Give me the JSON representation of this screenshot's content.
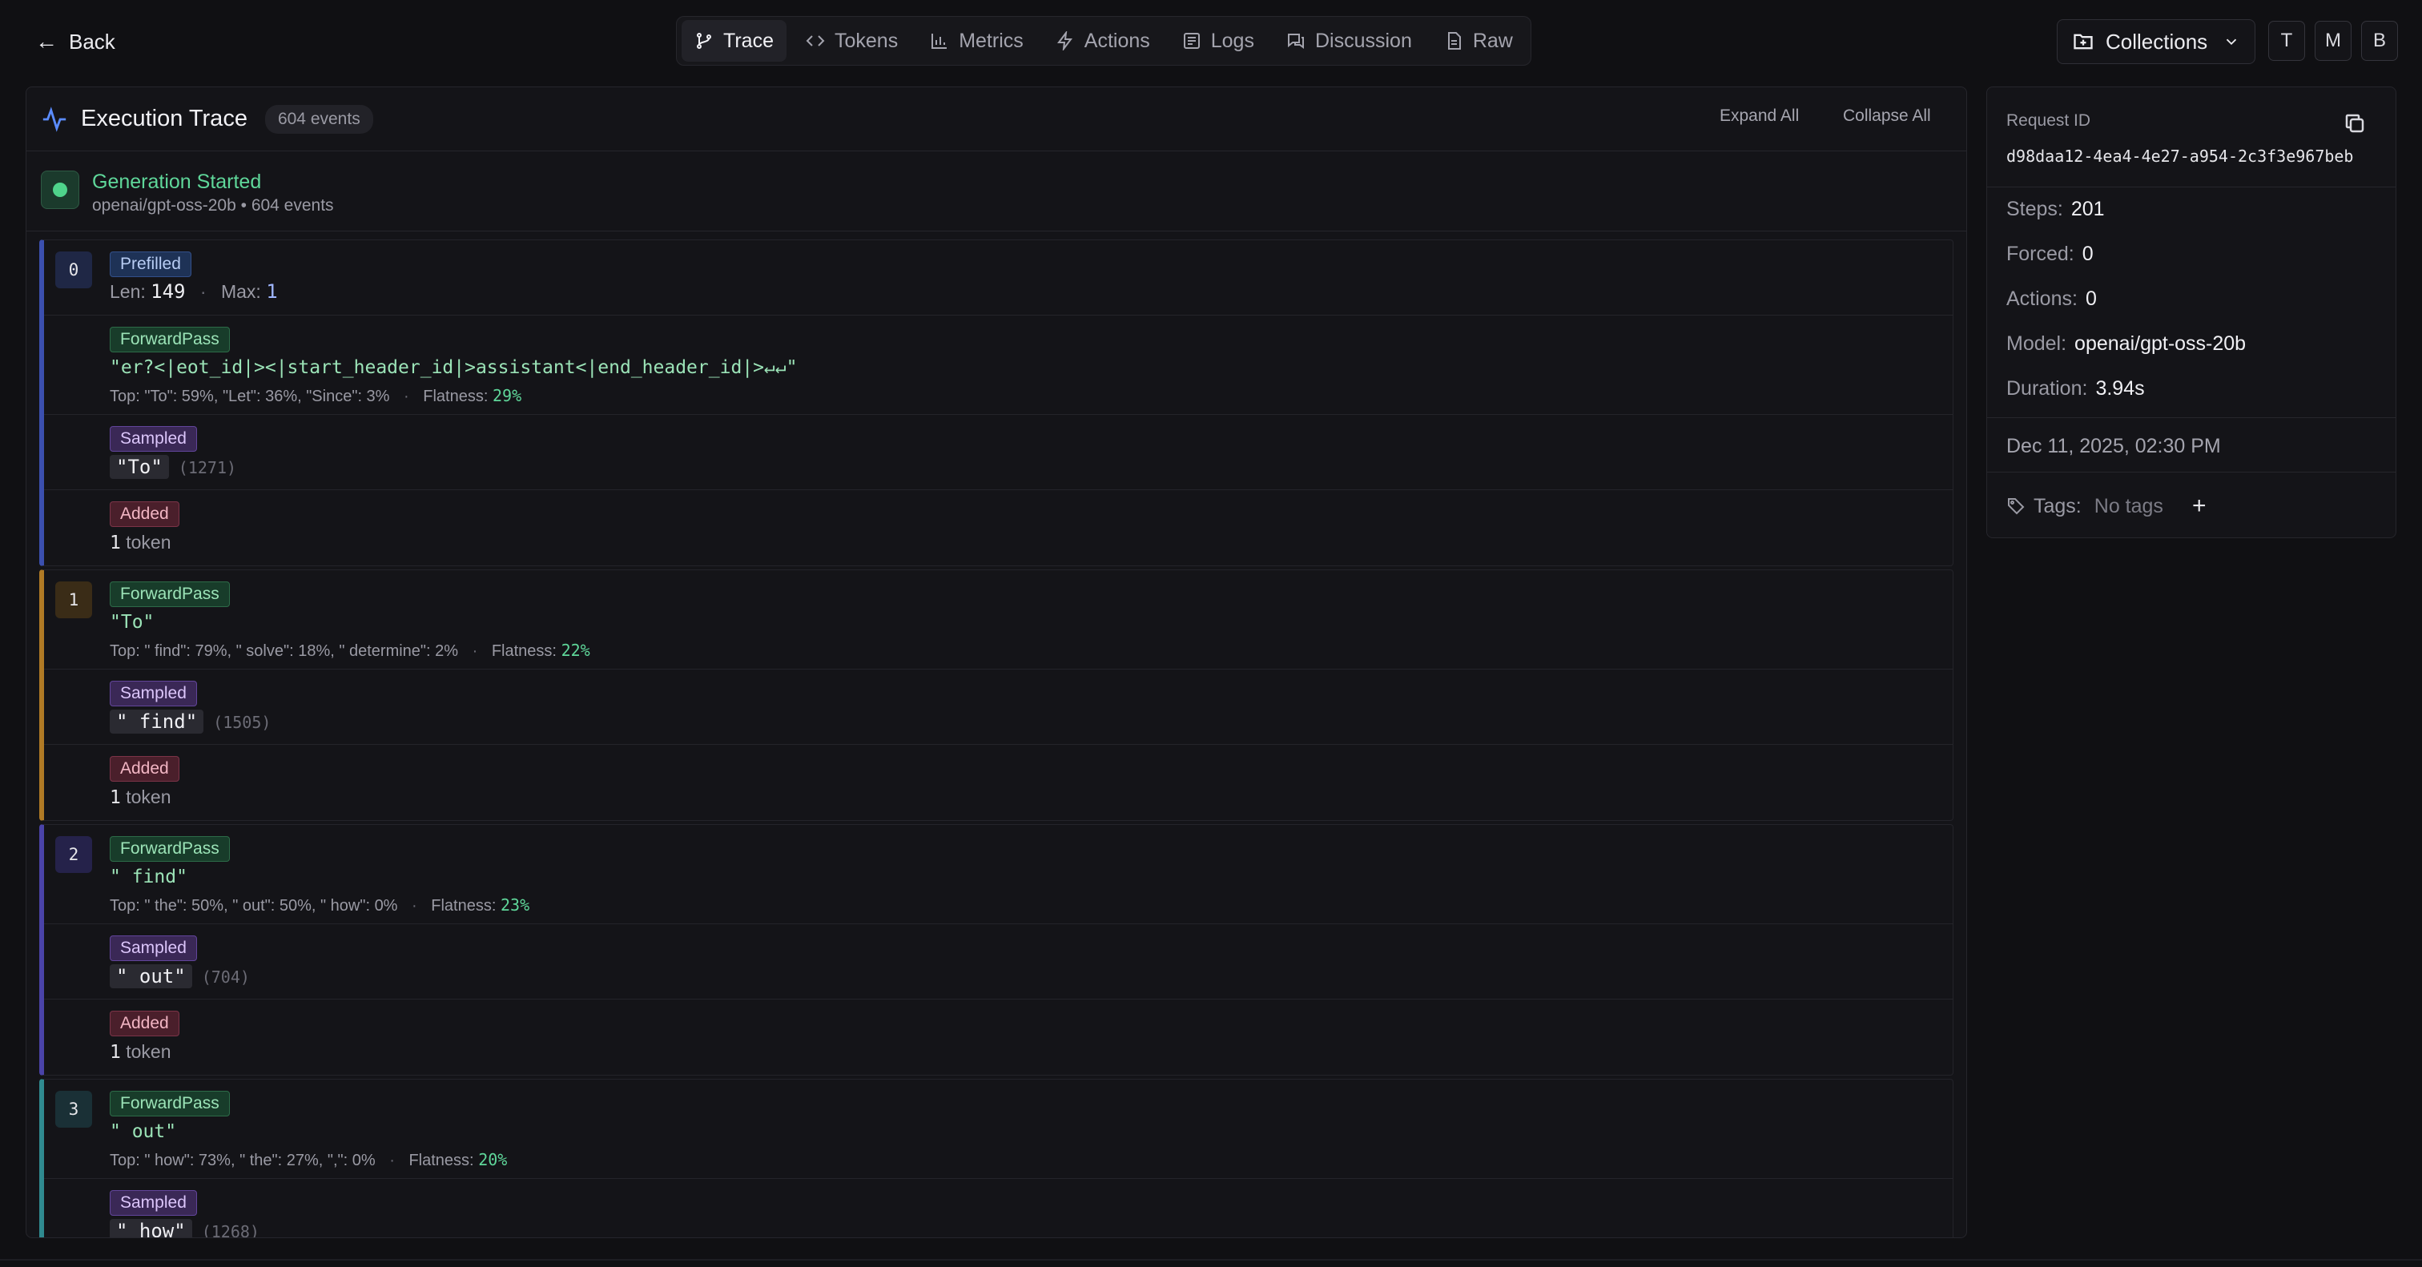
{
  "nav": {
    "back_label": "Back",
    "tabs": [
      {
        "label": "Trace",
        "icon": "branch-icon",
        "active": true
      },
      {
        "label": "Tokens",
        "icon": "code-icon",
        "active": false
      },
      {
        "label": "Metrics",
        "icon": "bar-chart-icon",
        "active": false
      },
      {
        "label": "Actions",
        "icon": "lightning-icon",
        "active": false
      },
      {
        "label": "Logs",
        "icon": "log-icon",
        "active": false
      },
      {
        "label": "Discussion",
        "icon": "chat-icon",
        "active": false
      },
      {
        "label": "Raw",
        "icon": "document-icon",
        "active": false
      }
    ],
    "collections_label": "Collections",
    "avatars": [
      "T",
      "M",
      "B"
    ]
  },
  "trace": {
    "title": "Execution Trace",
    "event_count": "604 events",
    "expand_all": "Expand All",
    "collapse_all": "Collapse All",
    "generation": {
      "title": "Generation Started",
      "subtitle": "openai/gpt-oss-20b • 604 events"
    },
    "steps": [
      {
        "index": "0",
        "prefill": {
          "badge": "Prefilled",
          "len_label": "Len:",
          "len": "149",
          "max_label": "Max:",
          "max": "1"
        },
        "forward": {
          "badge": "ForwardPass",
          "text": "\"er?<|eot_id|><|start_header_id|>assistant<|end_header_id|>↵↵\"",
          "top_label": "Top:",
          "top": "\"To\": 59%, \"Let\": 36%, \"Since\": 3%",
          "flat_label": "Flatness:",
          "flat": "29%"
        },
        "sampled": {
          "badge": "Sampled",
          "token": "\"To\"",
          "id": "(1271)"
        },
        "added": {
          "badge": "Added",
          "count": "1",
          "unit": "token"
        }
      },
      {
        "index": "1",
        "forward": {
          "badge": "ForwardPass",
          "text": "\"To\"",
          "top_label": "Top:",
          "top": "\" find\": 79%, \" solve\": 18%, \" determine\": 2%",
          "flat_label": "Flatness:",
          "flat": "22%"
        },
        "sampled": {
          "badge": "Sampled",
          "token": "\" find\"",
          "id": "(1505)"
        },
        "added": {
          "badge": "Added",
          "count": "1",
          "unit": "token"
        }
      },
      {
        "index": "2",
        "forward": {
          "badge": "ForwardPass",
          "text": "\" find\"",
          "top_label": "Top:",
          "top": "\" the\": 50%, \" out\": 50%, \" how\": 0%",
          "flat_label": "Flatness:",
          "flat": "23%"
        },
        "sampled": {
          "badge": "Sampled",
          "token": "\" out\"",
          "id": "(704)"
        },
        "added": {
          "badge": "Added",
          "count": "1",
          "unit": "token"
        }
      },
      {
        "index": "3",
        "forward": {
          "badge": "ForwardPass",
          "text": "\" out\"",
          "top_label": "Top:",
          "top": "\" how\": 73%, \" the\": 27%, \",\": 0%",
          "flat_label": "Flatness:",
          "flat": "20%"
        },
        "sampled": {
          "badge": "Sampled",
          "token": "\" how\"",
          "id": "(1268)"
        }
      }
    ]
  },
  "sidebar": {
    "request_id_label": "Request ID",
    "request_id": "d98daa12-4ea4-4e27-a954-2c3f3e967beb",
    "steps_label": "Steps:",
    "steps": "201",
    "forced_label": "Forced:",
    "forced": "0",
    "actions_label": "Actions:",
    "actions": "0",
    "model_label": "Model:",
    "model": "openai/gpt-oss-20b",
    "duration_label": "Duration:",
    "duration": "3.94s",
    "date": "Dec 11, 2025, 02:30 PM",
    "tags_label": "Tags:",
    "tags_value": "No tags"
  }
}
